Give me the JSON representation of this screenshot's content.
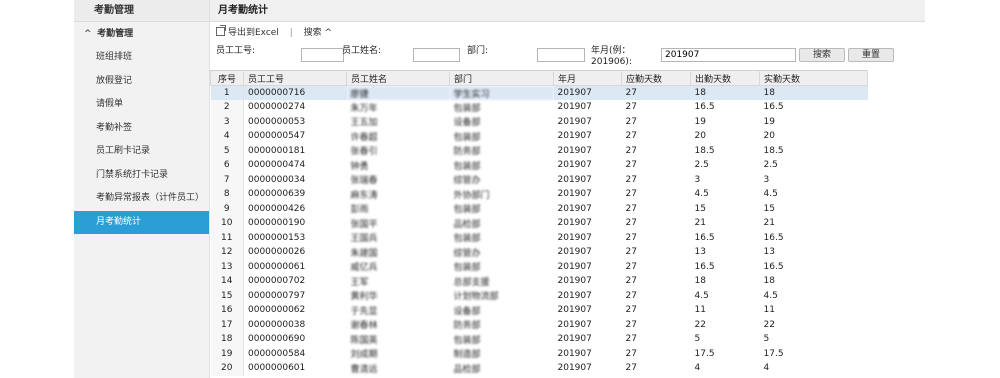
{
  "sidebar": {
    "title": "考勤管理",
    "group": "考勤管理",
    "items": [
      {
        "label": "班组排班",
        "active": false
      },
      {
        "label": "放假登记",
        "active": false
      },
      {
        "label": "请假单",
        "active": false
      },
      {
        "label": "考勤补签",
        "active": false
      },
      {
        "label": "员工刷卡记录",
        "active": false
      },
      {
        "label": "门禁系统打卡记录",
        "active": false
      },
      {
        "label": "考勤异常报表（计件员工）",
        "active": false
      },
      {
        "label": "月考勤统计",
        "active": true
      }
    ]
  },
  "page": {
    "title": "月考勤统计"
  },
  "toolbar": {
    "export_label": "导出到Excel",
    "separator": "|",
    "search_label": "搜索",
    "search_chevron": "^"
  },
  "search": {
    "emp_no_label": "员工工号:",
    "emp_no_value": "",
    "emp_name_label": "员工姓名:",
    "emp_name_value": "",
    "dept_label": "部门:",
    "dept_value": "",
    "month_label": "年月(例：201906):",
    "month_value": "201907",
    "search_button": "搜索",
    "reset_button": "重置"
  },
  "table": {
    "headers": [
      "序号",
      "员工工号",
      "员工姓名",
      "部门",
      "年月",
      "应勤天数",
      "出勤天数",
      "实勤天数"
    ],
    "rows": [
      [
        "1",
        "0000000716",
        "廖捷",
        "学生实习",
        "201907",
        "27",
        "18",
        "18"
      ],
      [
        "2",
        "0000000274",
        "朱万年",
        "包装部",
        "201907",
        "27",
        "16.5",
        "16.5"
      ],
      [
        "3",
        "0000000053",
        "王五加",
        "设备部",
        "201907",
        "27",
        "19",
        "19"
      ],
      [
        "4",
        "0000000547",
        "许春超",
        "包装部",
        "201907",
        "27",
        "20",
        "20"
      ],
      [
        "5",
        "0000000181",
        "张春引",
        "防务部",
        "201907",
        "27",
        "18.5",
        "18.5"
      ],
      [
        "6",
        "0000000474",
        "钟勇",
        "包装部",
        "201907",
        "27",
        "2.5",
        "2.5"
      ],
      [
        "7",
        "0000000034",
        "张瑞春",
        "综管办",
        "201907",
        "27",
        "3",
        "3"
      ],
      [
        "8",
        "0000000639",
        "麻东涛",
        "外协部门",
        "201907",
        "27",
        "4.5",
        "4.5"
      ],
      [
        "9",
        "0000000426",
        "彭雨",
        "包装部",
        "201907",
        "27",
        "15",
        "15"
      ],
      [
        "10",
        "0000000190",
        "张国平",
        "品检部",
        "201907",
        "27",
        "21",
        "21"
      ],
      [
        "11",
        "0000000153",
        "王国兵",
        "包装部",
        "201907",
        "27",
        "16.5",
        "16.5"
      ],
      [
        "12",
        "0000000026",
        "朱建国",
        "综管办",
        "201907",
        "27",
        "13",
        "13"
      ],
      [
        "13",
        "0000000061",
        "威亿兵",
        "包装部",
        "201907",
        "27",
        "16.5",
        "16.5"
      ],
      [
        "14",
        "0000000702",
        "王军",
        "总部支援",
        "201907",
        "27",
        "18",
        "18"
      ],
      [
        "15",
        "0000000797",
        "黄利华",
        "计划物流部",
        "201907",
        "27",
        "4.5",
        "4.5"
      ],
      [
        "16",
        "0000000062",
        "于先显",
        "设备部",
        "201907",
        "27",
        "11",
        "11"
      ],
      [
        "17",
        "0000000038",
        "谢春林",
        "防务部",
        "201907",
        "27",
        "22",
        "22"
      ],
      [
        "18",
        "0000000690",
        "陈国英",
        "包装部",
        "201907",
        "27",
        "5",
        "5"
      ],
      [
        "19",
        "0000000584",
        "刘成期",
        "制造部",
        "201907",
        "27",
        "17.5",
        "17.5"
      ],
      [
        "20",
        "0000000601",
        "曹清远",
        "品检部",
        "201907",
        "27",
        "4",
        "4"
      ]
    ]
  },
  "colors": {
    "accent": "#2a9fd6",
    "selected_row": "#dde8f5",
    "header_bg": "#efefef"
  }
}
